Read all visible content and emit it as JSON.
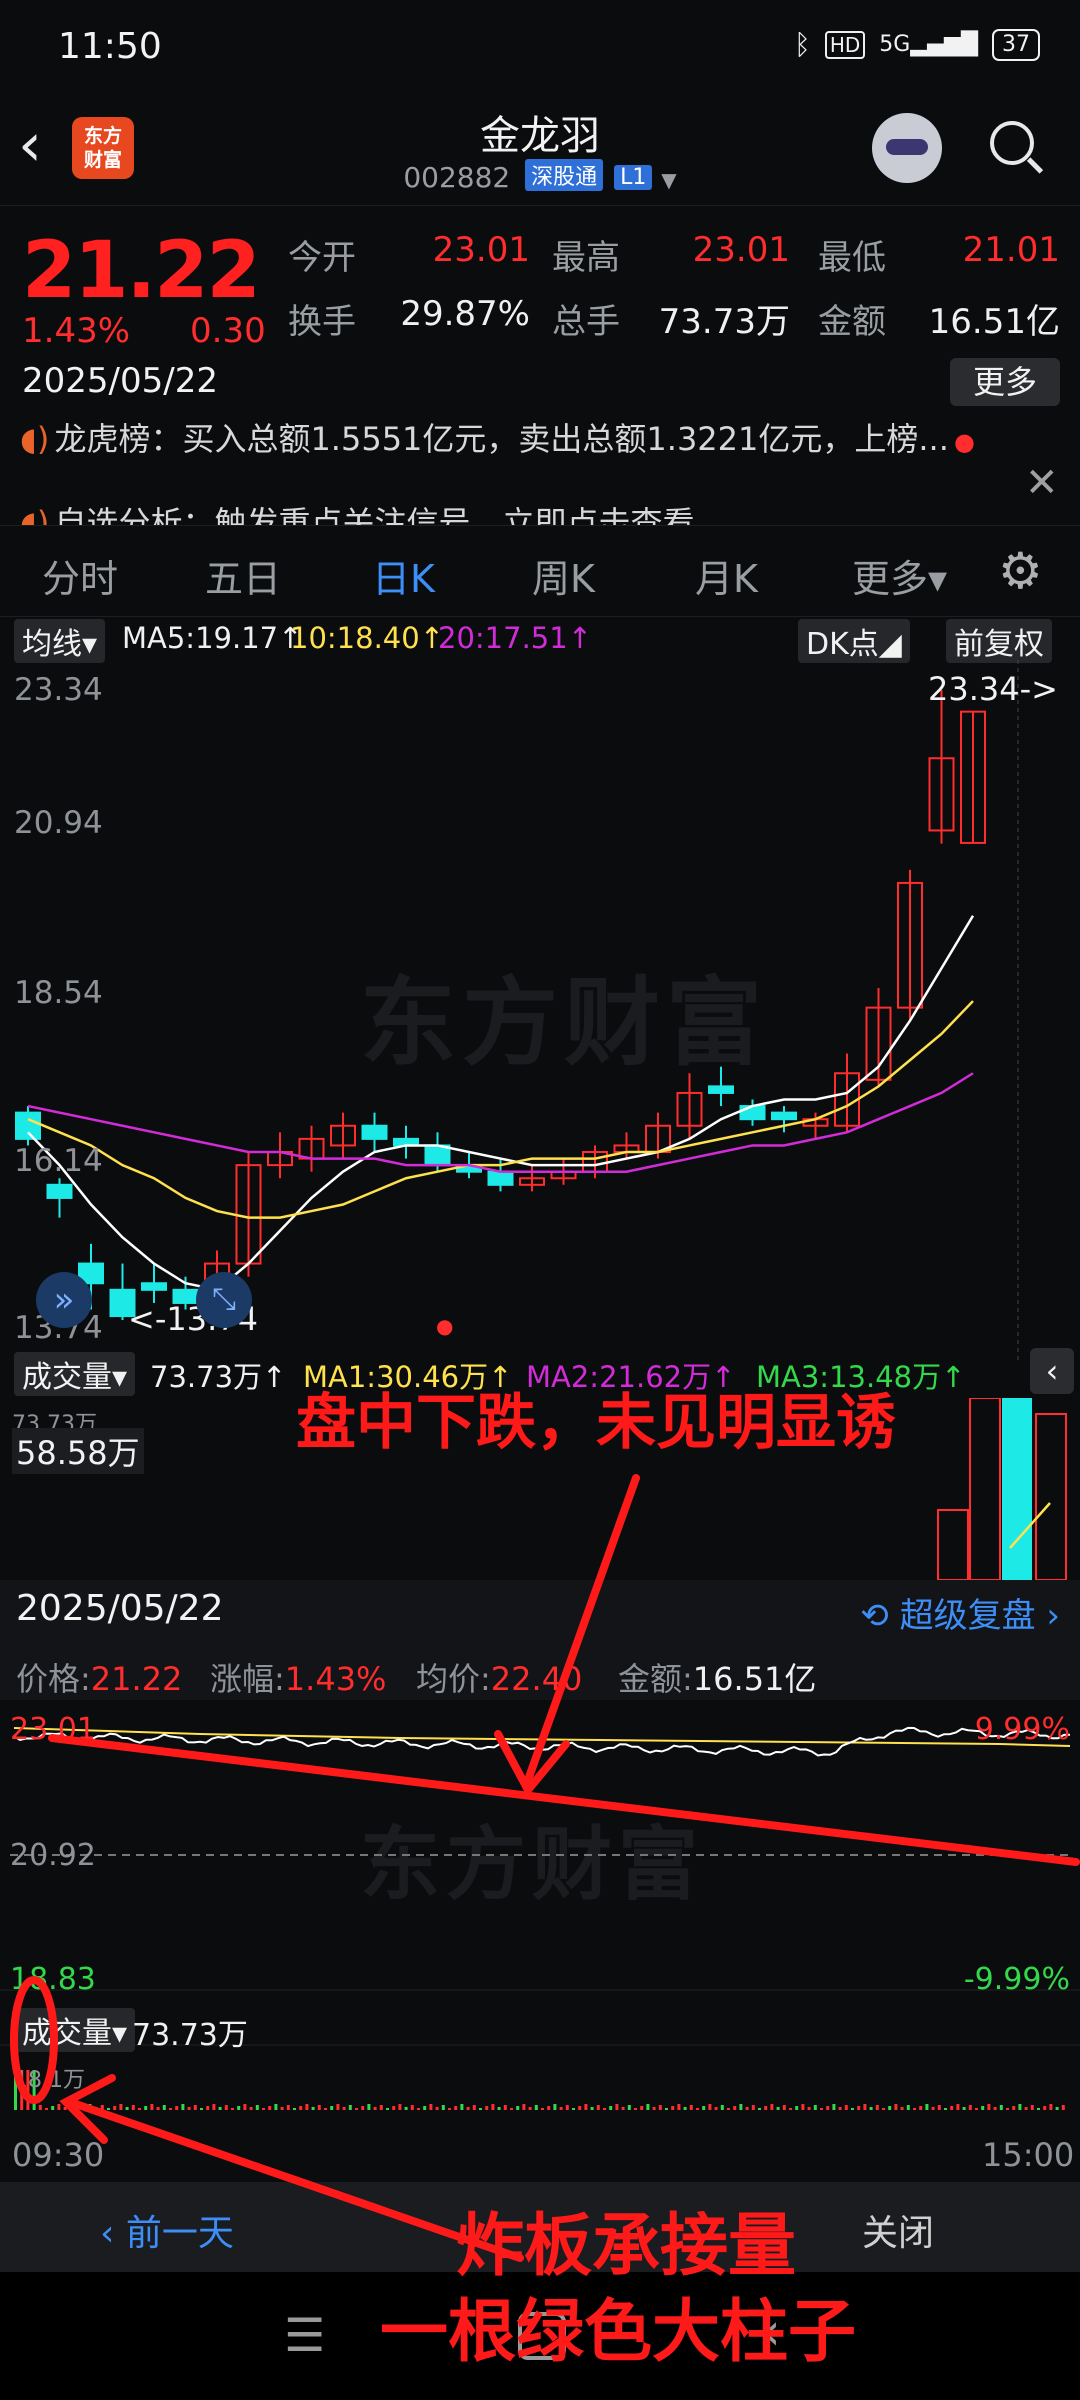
{
  "status": {
    "time": "11:50",
    "network": "5G",
    "battery": "37"
  },
  "header": {
    "back": "‹",
    "logo_line1": "东方",
    "logo_line2": "财富",
    "name": "金龙羽",
    "code": "002882",
    "tag1": "深股通",
    "tag2": "L1"
  },
  "quote": {
    "price": "21.22",
    "change_pct": "1.43%",
    "change": "0.30",
    "date": "2025/05/22",
    "open_label": "今开",
    "open": "23.01",
    "high_label": "最高",
    "high": "23.01",
    "low_label": "最低",
    "low": "21.01",
    "turnover_label": "换手",
    "turnover": "29.87%",
    "volume_label": "总手",
    "volume": "73.73万",
    "amount_label": "金额",
    "amount": "16.51亿",
    "more": "更多"
  },
  "ticker": {
    "line1": "龙虎榜：买入总额1.5551亿元，卖出总额1.3221亿元，上榜...",
    "line2": "自选分析：触发重点关注信号，立即点击查看"
  },
  "tabs": [
    "分时",
    "五日",
    "日K",
    "周K",
    "月K",
    "更多▾"
  ],
  "active_tab": "日K",
  "indicators": {
    "ma_btn": "均线▾",
    "ma5": "MA5:19.17↑",
    "ma10": "10:18.40↑",
    "ma20": "20:17.51↑",
    "dk_btn": "DK点◢",
    "adj_btn": "前复权"
  },
  "kchart": {
    "y_labels": [
      "23.34",
      "20.94",
      "18.54",
      "16.14",
      "13.74"
    ],
    "high_marker": "23.34->",
    "low_marker": "<-13.74",
    "watermark": "东方财富",
    "vol_btn": "成交量▾",
    "vol_value": "73.73万↑",
    "vol_ma1": "MA1:30.46万↑",
    "vol_ma2": "MA2:21.62万↑",
    "vol_ma3": "MA3:13.48万↑",
    "vol_scale": "58.58万",
    "vol_top": "73.73万"
  },
  "detail": {
    "date": "2025/05/22",
    "super": "超级复盘 ›",
    "price_label": "价格:",
    "price": "21.22",
    "pct_label": "涨幅:",
    "pct": "1.43%",
    "avg_label": "均价:",
    "avg": "22.40",
    "amt_label": "金额:",
    "amt": "16.51亿"
  },
  "intraday": {
    "top_price": "23.01",
    "mid_price": "20.92",
    "low_price": "18.83",
    "top_pct": "9.99%",
    "low_pct": "-9.99%",
    "watermark": "东方财富",
    "vol_btn": "成交量▾",
    "vol_value": "73.73万",
    "vol_scale": "18.1万",
    "t_start": "09:30",
    "t_end": "15:00"
  },
  "nav": {
    "prev": "‹ 前一天",
    "close": "关闭"
  },
  "annotations": {
    "a1": "盘中下跌，未见明显诱",
    "a2": "炸板承接量",
    "a3": "一根绿色大柱子"
  },
  "colors": {
    "up": "#ff2d2d",
    "down": "#1de9e6",
    "ma5": "#ffffff",
    "ma10": "#ffe14d",
    "ma20": "#d22cd8",
    "accent": "#3e8ef7"
  }
}
